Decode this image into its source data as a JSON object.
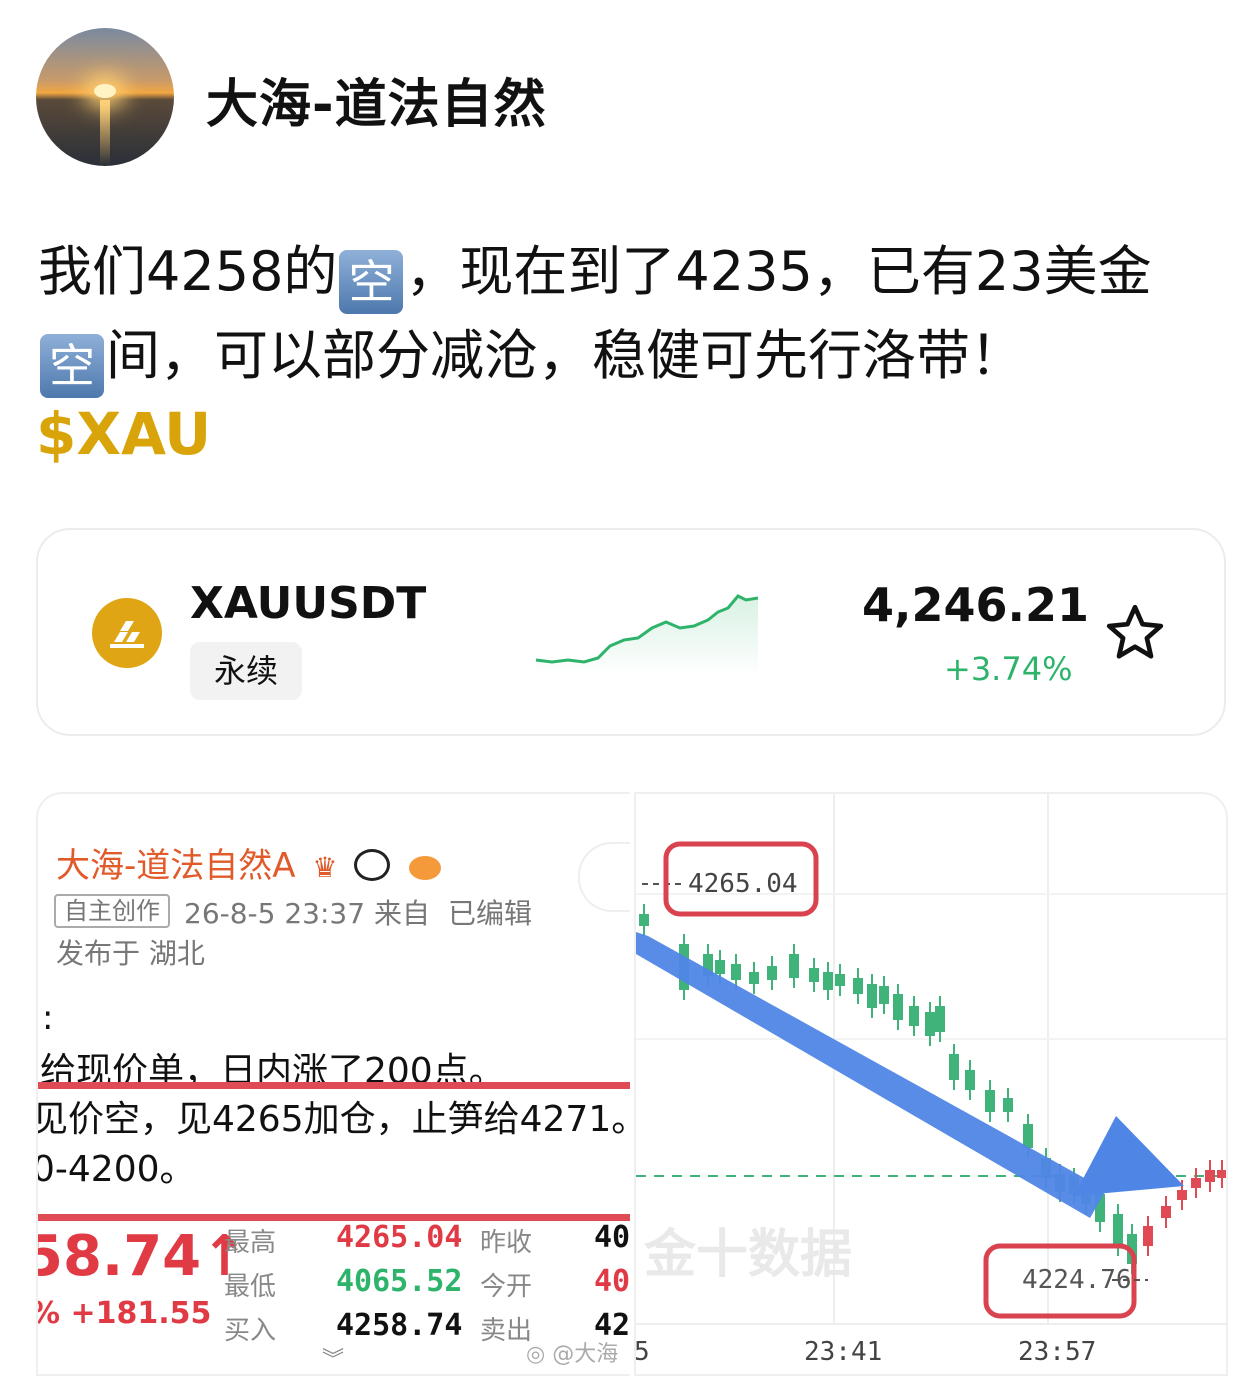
{
  "author": {
    "name": "大海-道法自然"
  },
  "post": {
    "line1_a": "我们4258的",
    "emoji": "空",
    "line1_b": "，现在到了4235，已有23美金",
    "line2_b": "间，可以部分减沧，稳健可先行洛带！",
    "tag": "$XAU"
  },
  "ticker": {
    "symbol": "XAUUSDT",
    "type_label": "永续",
    "price": "4,246.21",
    "change": "+3.74%",
    "colors": {
      "up": "#2db46a",
      "coin": "#e0a515"
    },
    "icons": [
      "gold-bars-icon",
      "star-icon"
    ]
  },
  "screenshot_left": {
    "name": "大海-道法自然A",
    "badges": [
      "crown-icon",
      "panda-icon",
      "fish-icon"
    ],
    "original_label": "自主创作",
    "meta": "26-8-5 23:37  来自",
    "edited": "已编辑",
    "location": "发布于 湖北",
    "colon": ":",
    "text_line1": "给现价单，日内涨了200点。",
    "text_line2": "见价空，见4265加仓，止笋给4271。",
    "text_line3": "0-4200。",
    "big_price": "58.74↑",
    "pct": "%  +181.55",
    "quote": {
      "high_label": "最高",
      "high": "4265.04",
      "low_label": "最低",
      "low": "4065.52",
      "buy_label": "买入",
      "buy": "4258.74",
      "prev_close_label": "昨收",
      "prev_close": "40",
      "open_label": "今开",
      "open": "40",
      "sell_label": "卖出",
      "sell": "42"
    }
  },
  "screenshot_right": {
    "high_label": "4265.04",
    "low_label": "4224.76",
    "time_labels": [
      "5",
      "23:41",
      "23:57"
    ],
    "watermark": "金十数据",
    "weibo_watermark": "@大海"
  }
}
